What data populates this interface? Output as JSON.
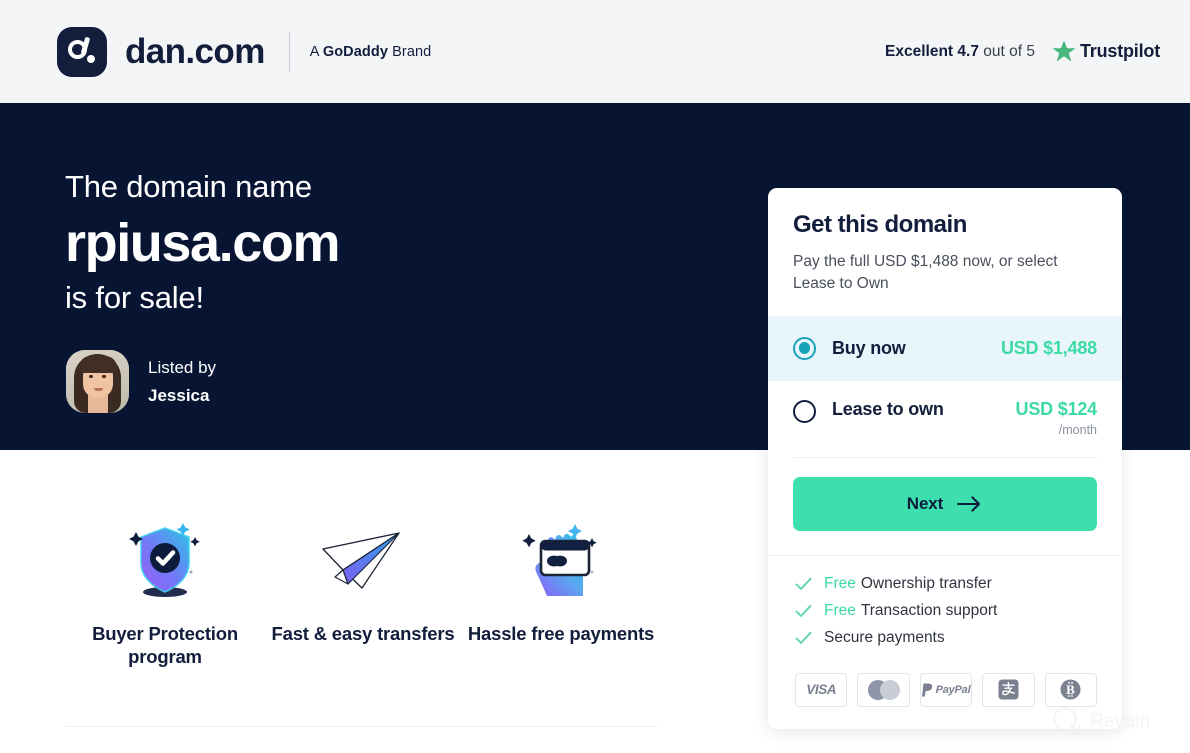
{
  "header": {
    "logo_word": "dan.com",
    "logo_icon": "dan-logo-icon",
    "brand_tagline_prefix": "A ",
    "brand_tagline_bold": "GoDaddy",
    "brand_tagline_suffix": " Brand",
    "trust": {
      "rating_label": "Excellent",
      "rating_value": "4.7",
      "out_of": "out of 5",
      "star_icon": "trustpilot-star-icon",
      "logo_name": "Trustpilot"
    }
  },
  "hero": {
    "line1": "The domain name",
    "domain": "rpiusa.com",
    "line3": "is for sale!",
    "lister": {
      "avatar_icon": "seller-avatar",
      "label": "Listed by",
      "name": "Jessica"
    }
  },
  "features": [
    {
      "icon": "shield-check-icon",
      "label": "Buyer Protection program"
    },
    {
      "icon": "paper-plane-icon",
      "label": "Fast & easy transfers"
    },
    {
      "icon": "hand-credit-card-icon",
      "label": "Hassle free payments"
    }
  ],
  "offer_card": {
    "title": "Get this domain",
    "subtitle": "Pay the full USD $1,488 now, or select Lease to Own",
    "options": [
      {
        "label": "Buy now",
        "price": "USD $1,488",
        "per": "",
        "selected": true
      },
      {
        "label": "Lease to own",
        "price": "USD $124",
        "per": "/month",
        "selected": false
      }
    ],
    "next_label": "Next",
    "next_icon": "arrow-right-icon",
    "benefits": [
      {
        "highlight": "Free",
        "text": "Ownership transfer"
      },
      {
        "highlight": "Free",
        "text": "Transaction support"
      },
      {
        "highlight": "",
        "text": "Secure payments"
      }
    ],
    "payment_methods": [
      "visa-icon",
      "mastercard-icon",
      "paypal-icon",
      "alipay-icon",
      "bitcoin-icon"
    ],
    "payment_labels": {
      "visa": "VISA",
      "paypal": "PayPal"
    }
  },
  "watermark": {
    "icon": "revain-logo-icon",
    "text": "Revain"
  },
  "colors": {
    "hero_bg": "#071533",
    "header_bg": "#f4f5f7",
    "accent_green": "#3ddfae",
    "price_green": "#3ddaa4",
    "radio_selected": "#19a3bb",
    "selected_row_bg": "#e8f6fb",
    "navy_text": "#131e3c",
    "trustpilot_green": "#49b87c"
  }
}
